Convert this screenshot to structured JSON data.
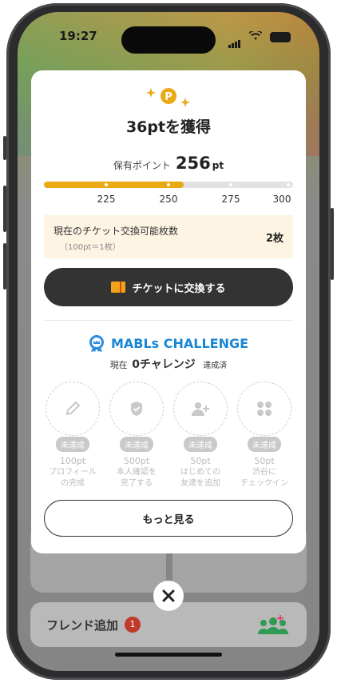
{
  "status_bar": {
    "time": "19:27"
  },
  "modal": {
    "title": "36ptを獲得",
    "points_label": "保有ポイント",
    "points_value": "256",
    "points_unit": "pt",
    "progress": {
      "min": 200,
      "max": 300,
      "value": 256,
      "ticks": [
        "225",
        "250",
        "275",
        "300"
      ]
    },
    "ticket_box": {
      "label": "現在のチケット交換可能枚数",
      "note": "（100pt＝1枚）",
      "count": "2枚"
    },
    "exchange_button": "チケットに交換する",
    "challenge": {
      "title": "MABLs CHALLENGE",
      "current_prefix": "現在",
      "current_value": "0チャレンジ",
      "current_suffix": "達成済",
      "items": [
        {
          "icon": "pencil-icon",
          "state": "未達成",
          "points": "100pt",
          "desc1": "プロフィール",
          "desc2": "の完成"
        },
        {
          "icon": "shield-check-icon",
          "state": "未達成",
          "points": "500pt",
          "desc1": "本人確認を",
          "desc2": "完了する"
        },
        {
          "icon": "add-user-icon",
          "state": "未達成",
          "points": "50pt",
          "desc1": "はじめての",
          "desc2": "友達を追加"
        },
        {
          "icon": "dots-icon",
          "state": "未達成",
          "points": "50pt",
          "desc1": "渋谷に",
          "desc2": "チェックイン"
        }
      ]
    },
    "more_button": "もっと見る"
  },
  "background": {
    "friend_add_label": "フレンド追加",
    "friend_add_badge": "1"
  },
  "colors": {
    "accent": "#e8a915",
    "challenge_blue": "#1a87d6",
    "button_dark": "#333333"
  }
}
